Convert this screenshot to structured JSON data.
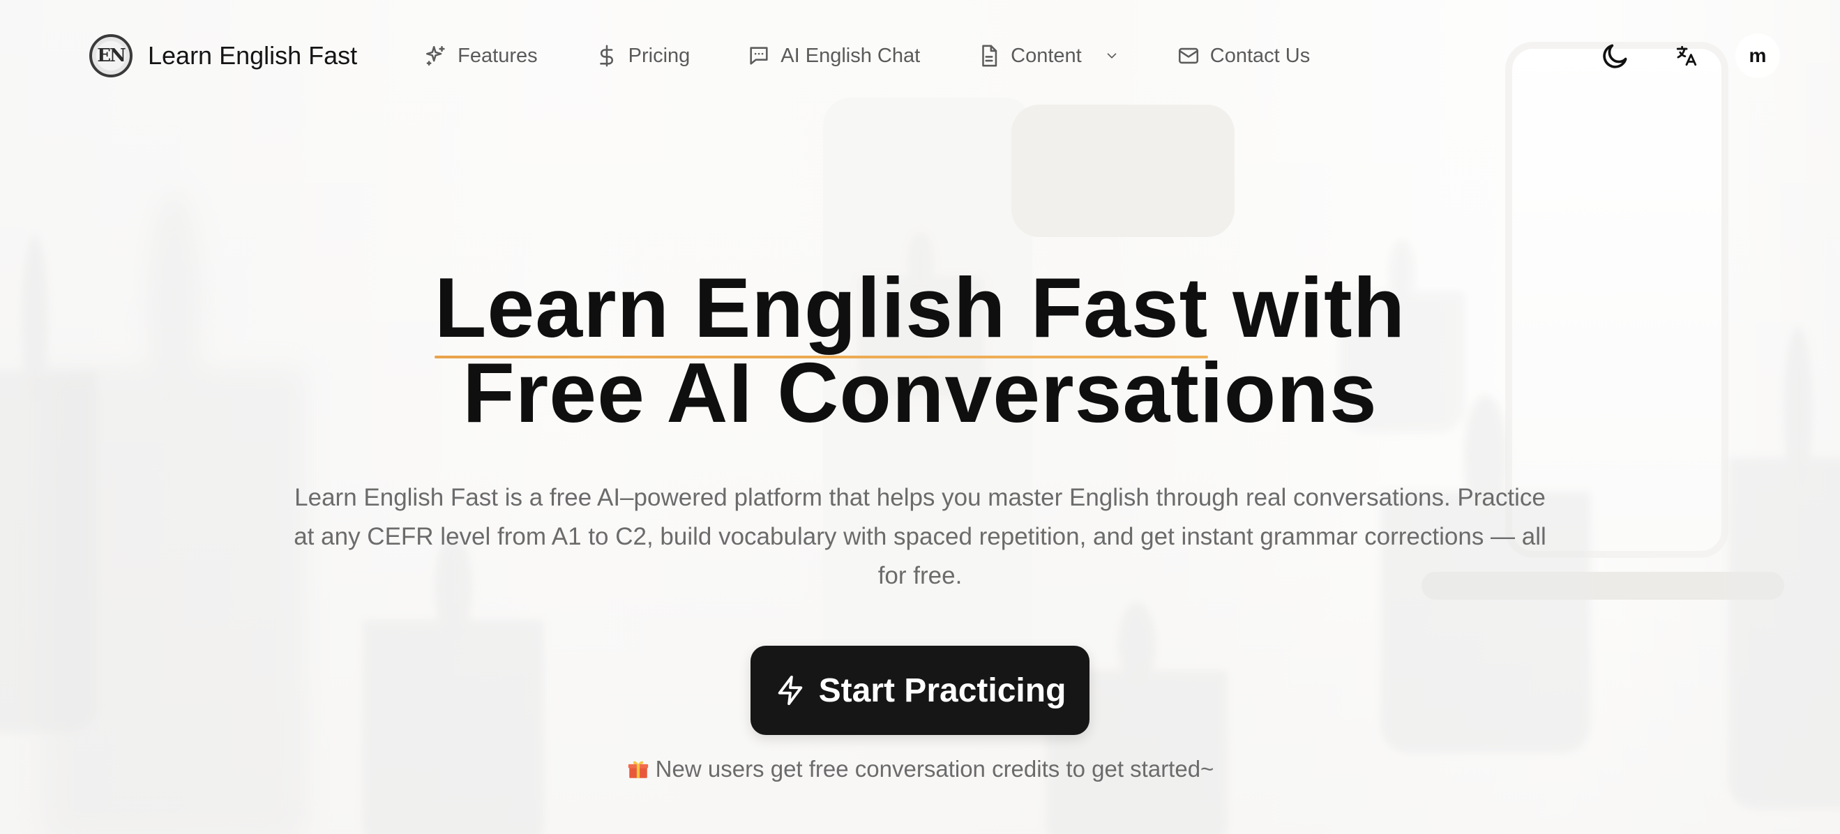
{
  "brand": {
    "name": "Learn English Fast",
    "logo_text": "EN"
  },
  "nav": {
    "features": "Features",
    "pricing": "Pricing",
    "ai_chat": "AI English Chat",
    "content": "Content",
    "contact": "Contact Us"
  },
  "header": {
    "avatar_initial": "m"
  },
  "hero": {
    "title_highlight": "Learn English Fast",
    "title_rest_line1": " with",
    "title_line2": "Free AI Conversations",
    "subtitle": "Learn English Fast is a free AI–powered platform that helps you master English through real conversations. Practice at any CEFR level from A1 to C2, build vocabulary with spaced repetition, and get instant grammar corrections — all for free.",
    "cta_label": "Start Practicing",
    "note": "New users get free conversation credits to get started~"
  },
  "colors": {
    "accent_underline": "#e9a34c",
    "cta_background": "#161616"
  },
  "icons": {
    "features": "sparkles-icon",
    "pricing": "dollar-icon",
    "ai_chat": "chat-bubble-icon",
    "content": "document-icon",
    "contact": "mail-icon",
    "theme": "moon-icon",
    "language": "translate-icon",
    "cta": "lightning-icon",
    "note": "gift-icon"
  }
}
